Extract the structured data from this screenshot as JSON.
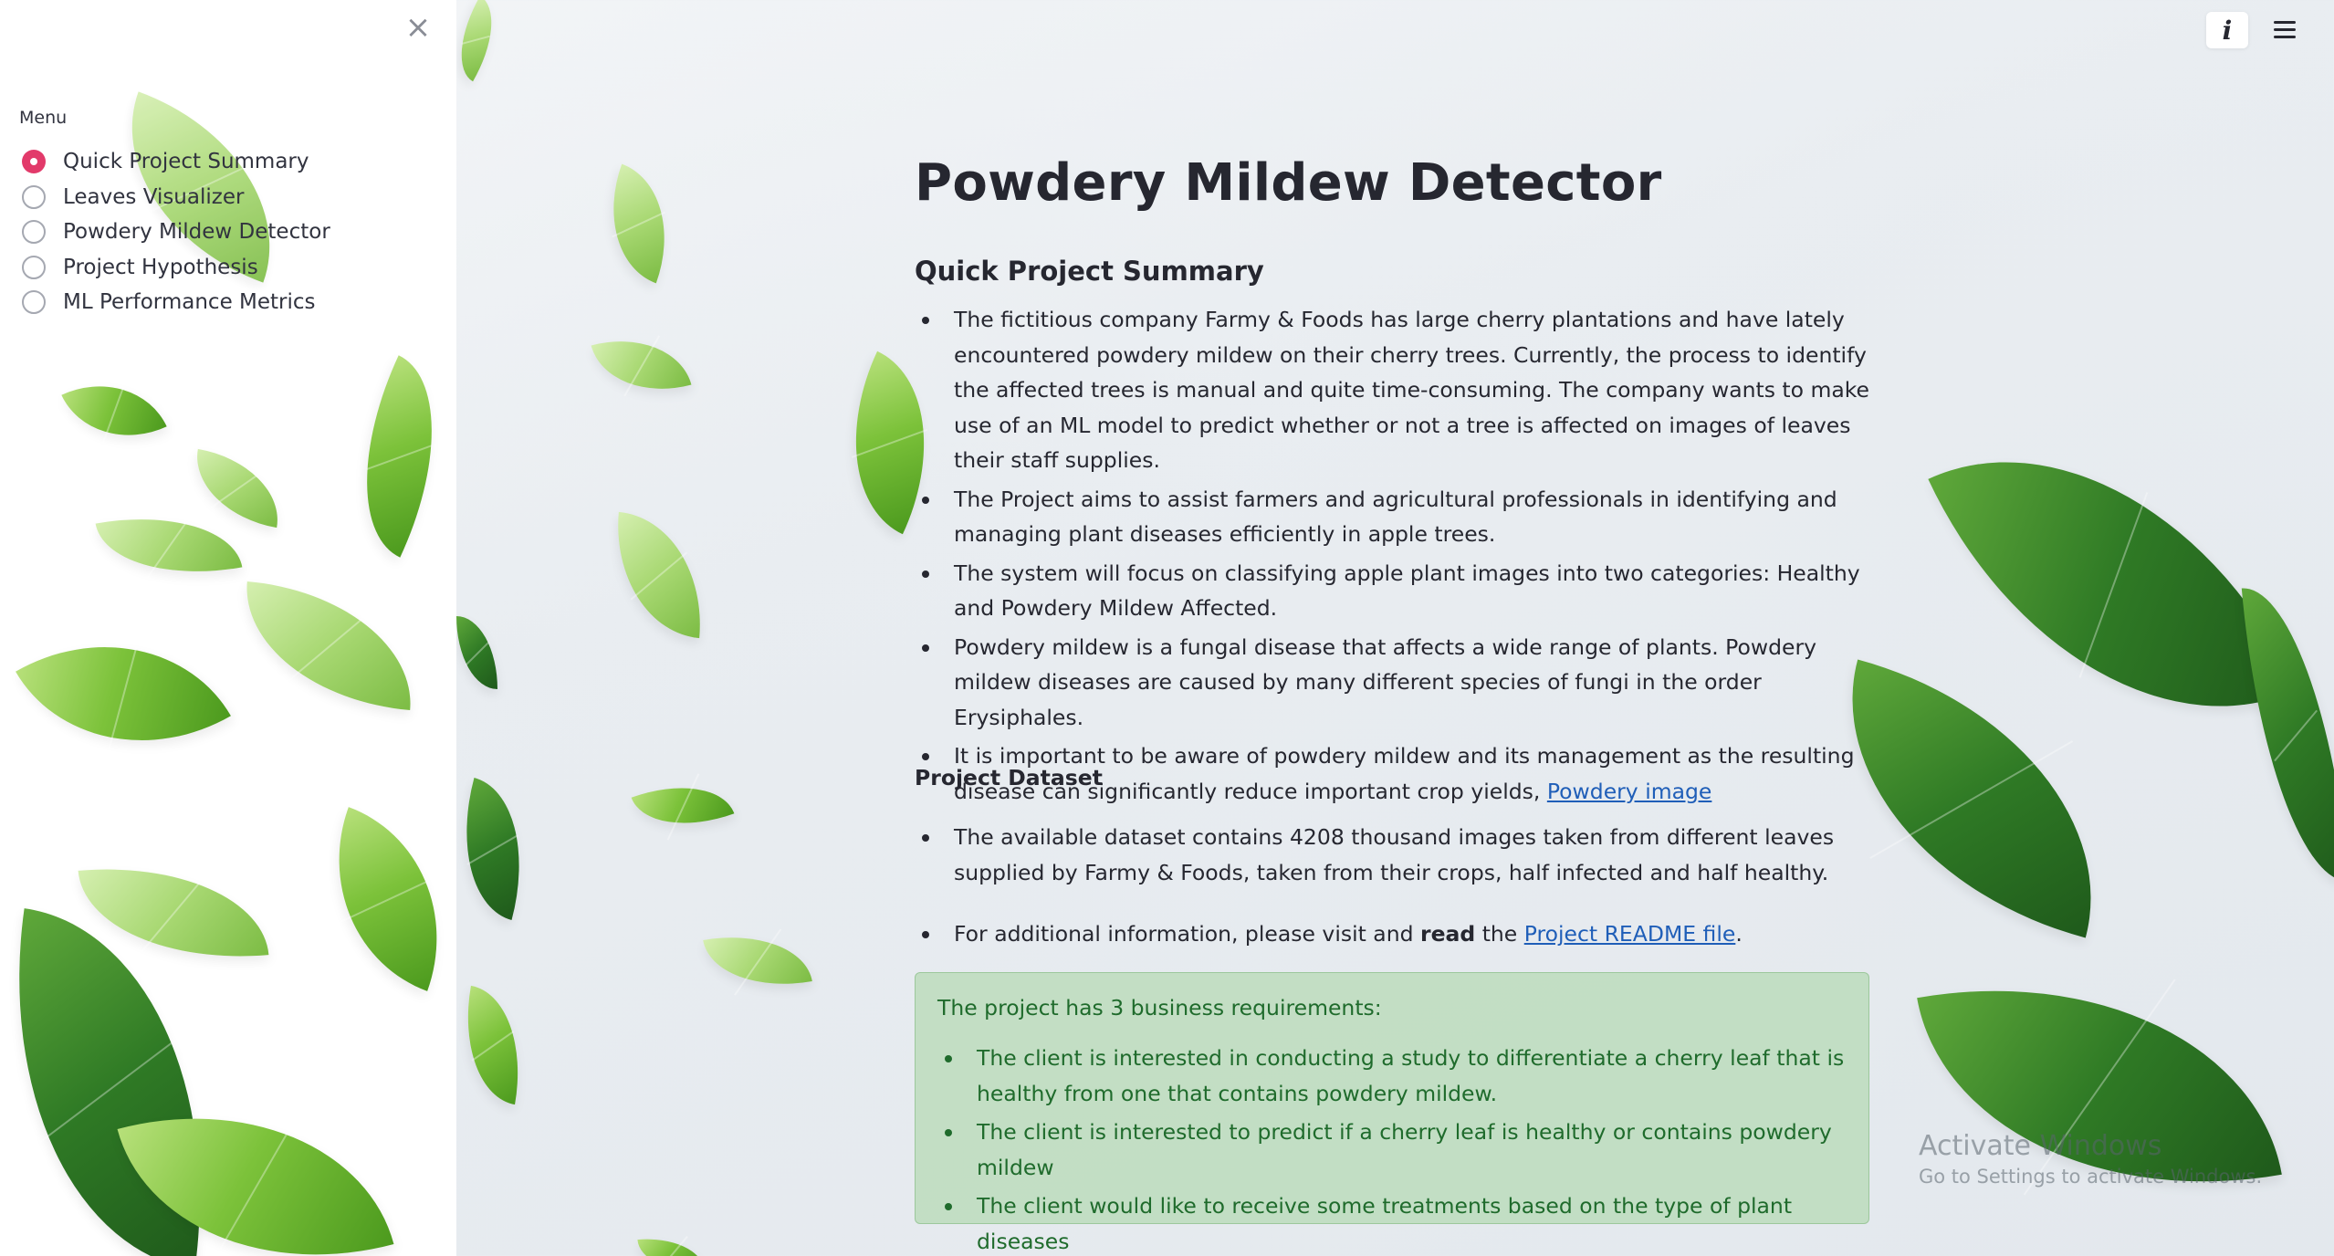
{
  "sidebar": {
    "close_glyph": "×",
    "menu_label": "Menu",
    "items": [
      {
        "label": "Quick Project Summary",
        "selected": true
      },
      {
        "label": "Leaves Visualizer",
        "selected": false
      },
      {
        "label": "Powdery Mildew Detector",
        "selected": false
      },
      {
        "label": "Project Hypothesis",
        "selected": false
      },
      {
        "label": "ML Performance Metrics",
        "selected": false
      }
    ]
  },
  "header": {
    "info_glyph": "i",
    "menu_icon": "hamburger-icon"
  },
  "main": {
    "title": "Powdery Mildew Detector",
    "summary_heading": "Quick Project Summary",
    "summary_bullets": [
      "The fictitious company Farmy & Foods has large cherry plantations and have lately encountered powdery mildew on their cherry trees. Currently, the process to identify the affected trees is manual and quite time-consuming. The company wants to make use of an ML model to predict whether or not a tree is affected on images of leaves their staff supplies.",
      "The Project aims to assist farmers and agricultural professionals in identifying and managing plant diseases efficiently in apple trees.",
      "The system will focus on classifying apple plant images into two categories: Healthy and Powdery Mildew Affected.",
      "Powdery mildew is a fungal disease that affects a wide range of plants. Powdery mildew diseases are caused by many different species of fungi in the order Erysiphales."
    ],
    "summary_last_bullet_text": "It is important to be aware of powdery mildew and its management as the resulting disease can significantly reduce important crop yields, ",
    "summary_last_bullet_link": "Powdery image",
    "dataset_heading": "Project Dataset",
    "dataset_bullet": "The available dataset contains 4208 thousand images taken from different leaves supplied by Farmy & Foods, taken from their crops, half infected and half healthy.",
    "info_bullet_pre": "For additional information, please visit and ",
    "info_bullet_bold": "read",
    "info_bullet_mid": " the ",
    "info_bullet_link": "Project README file",
    "info_bullet_post": ".",
    "requirements_intro": "The project has 3 business requirements:",
    "requirements": [
      "The client is interested in conducting a study to differentiate a cherry leaf that is healthy from one that contains powdery mildew.",
      "The client is interested to predict if a cherry leaf is healthy or contains powdery mildew",
      "The client would like to receive some treatments based on the type of plant diseases"
    ]
  },
  "watermark": {
    "title": "Activate Windows",
    "subtitle": "Go to Settings to activate Windows."
  },
  "colors": {
    "accent": "#e23a6a",
    "link": "#1f5eb8",
    "success_text": "#1f6b2c",
    "success_bg": "#add6aa"
  }
}
